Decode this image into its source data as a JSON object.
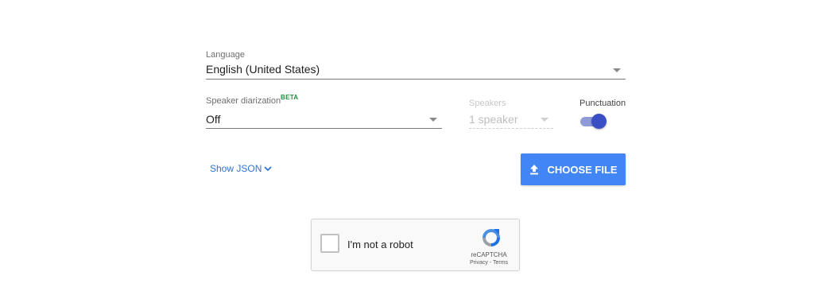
{
  "language": {
    "label": "Language",
    "value": "English (United States)"
  },
  "diarization": {
    "label": "Speaker diarization",
    "badge": "BETA",
    "value": "Off"
  },
  "speakers": {
    "label": "Speakers",
    "value": "1 speaker",
    "disabled": true
  },
  "punctuation": {
    "label": "Punctuation",
    "enabled": true
  },
  "show_json": {
    "label": "Show JSON",
    "icon": "chevron-down-icon"
  },
  "choose_file": {
    "label": "CHOOSE FILE",
    "icon": "upload-icon"
  },
  "recaptcha": {
    "checkbox_label": "I'm not a robot",
    "brand": "reCAPTCHA",
    "links": "Privacy - Terms"
  },
  "colors": {
    "primary": "#4285f4",
    "toggle_thumb": "#3b4fc4",
    "toggle_track": "#8e9bd6",
    "link": "#2f73d1",
    "beta": "#1e8e3e"
  }
}
